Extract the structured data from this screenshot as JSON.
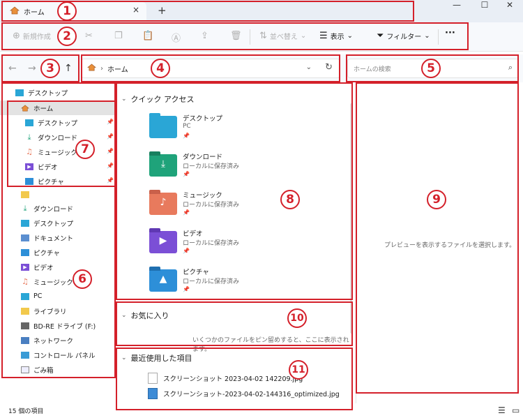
{
  "tabbar": {
    "tab_title": "ホーム",
    "close_glyph": "×",
    "new_tab_glyph": "+",
    "window_controls": [
      "—",
      "☐",
      "✕"
    ]
  },
  "toolbar": {
    "new_label": "新規作成",
    "sort_label": "並べ替え",
    "view_label": "表示",
    "filter_label": "フィルター",
    "more_glyph": "···"
  },
  "address": {
    "path": "ホーム",
    "separator": "›"
  },
  "search": {
    "placeholder": "ホームの検索"
  },
  "sidebar": {
    "top_item": "デスクトップ",
    "home": "ホーム",
    "pinned": [
      {
        "label": "デスクトップ",
        "icon": "desktop-icon"
      },
      {
        "label": "ダウンロード",
        "icon": "download-icon"
      },
      {
        "label": "ミュージック",
        "icon": "music-icon"
      },
      {
        "label": "ビデオ",
        "icon": "video-icon"
      },
      {
        "label": "ピクチャ",
        "icon": "picture-icon"
      }
    ],
    "items": [
      {
        "label": "ダウンロード",
        "icon": "download-icon"
      },
      {
        "label": "デスクトップ",
        "icon": "desktop-icon"
      },
      {
        "label": "ドキュメント",
        "icon": "document-icon"
      },
      {
        "label": "ピクチャ",
        "icon": "picture-icon"
      },
      {
        "label": "ビデオ",
        "icon": "video-icon"
      },
      {
        "label": "ミュージック",
        "icon": "music-icon"
      },
      {
        "label": "PC",
        "icon": "pc-icon"
      },
      {
        "label": "ライブラリ",
        "icon": "library-icon"
      },
      {
        "label": "BD-RE ドライブ (F:)",
        "icon": "drive-icon"
      },
      {
        "label": "ネットワーク",
        "icon": "network-icon"
      },
      {
        "label": "コントロール パネル",
        "icon": "control-panel-icon"
      },
      {
        "label": "ごみ箱",
        "icon": "recycle-bin-icon"
      }
    ]
  },
  "quick_access": {
    "title": "クイック アクセス",
    "folders": [
      {
        "name": "デスクトップ",
        "sub": "PC",
        "color": "#2aa6d6"
      },
      {
        "name": "ダウンロード",
        "sub": "ローカルに保存済み",
        "color": "#1fa37a"
      },
      {
        "name": "ミュージック",
        "sub": "ローカルに保存済み",
        "color": "#e87a5d"
      },
      {
        "name": "ビデオ",
        "sub": "ローカルに保存済み",
        "color": "#7b4fd6"
      },
      {
        "name": "ピクチャ",
        "sub": "ローカルに保存済み",
        "color": "#2d8fd8"
      }
    ]
  },
  "favorites": {
    "title": "お気に入り",
    "empty_message": "いくつかのファイルをピン留めすると、ここに表示されます。"
  },
  "recent": {
    "title": "最近使用した項目",
    "files": [
      "スクリーンショット 2023-04-02 142209.jpg",
      "スクリーンショット-2023-04-02-144316_optimized.jpg"
    ]
  },
  "preview": {
    "message": "プレビューを表示するファイルを選択します。"
  },
  "status": {
    "item_count": "15 個の項目"
  },
  "annotations": [
    "1",
    "2",
    "3",
    "4",
    "5",
    "6",
    "7",
    "8",
    "9",
    "10",
    "11"
  ],
  "colors": {
    "annotation_red": "#d4202a",
    "selection_gray": "#e3e3e3",
    "toolbar_bg": "#f7f9fc"
  }
}
